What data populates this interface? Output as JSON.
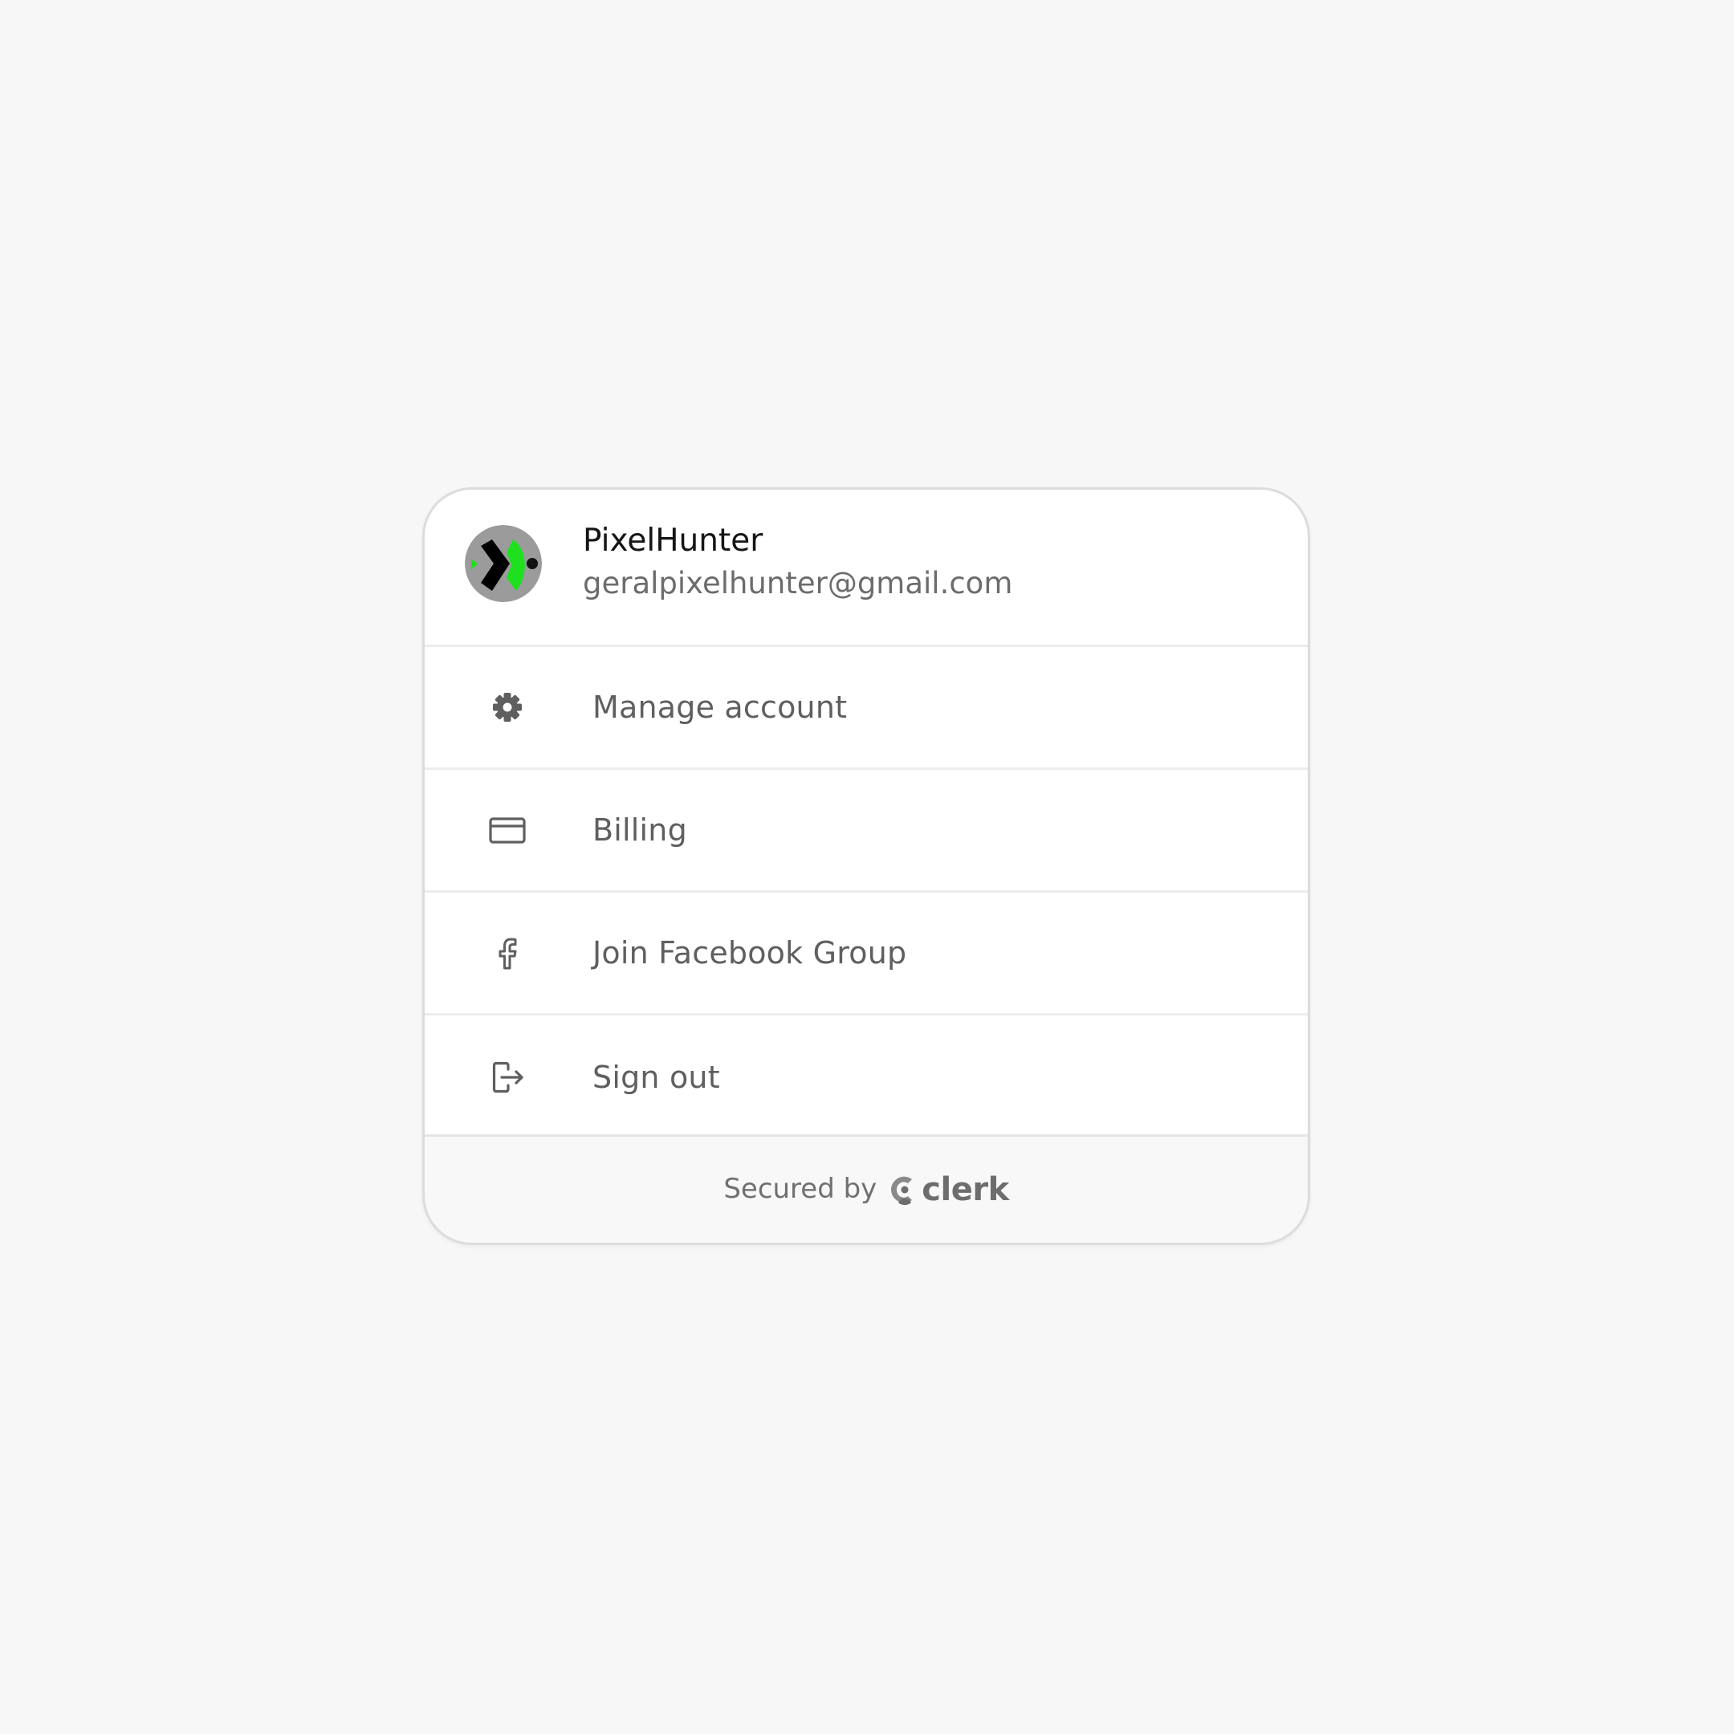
{
  "user": {
    "name": "PixelHunter",
    "email": "geralpixelhunter@gmail.com"
  },
  "menu": {
    "items": [
      {
        "label": "Manage account",
        "icon": "gear-icon"
      },
      {
        "label": "Billing",
        "icon": "credit-card-icon"
      },
      {
        "label": "Join Facebook Group",
        "icon": "facebook-icon"
      },
      {
        "label": "Sign out",
        "icon": "sign-out-icon"
      }
    ]
  },
  "footer": {
    "secured_by": "Secured by",
    "brand": "clerk"
  },
  "colors": {
    "background": "#f7f7f7",
    "card": "#ffffff",
    "text_primary": "#151515",
    "text_secondary": "#6c6c6c",
    "avatar_green": "#1fe01f"
  }
}
